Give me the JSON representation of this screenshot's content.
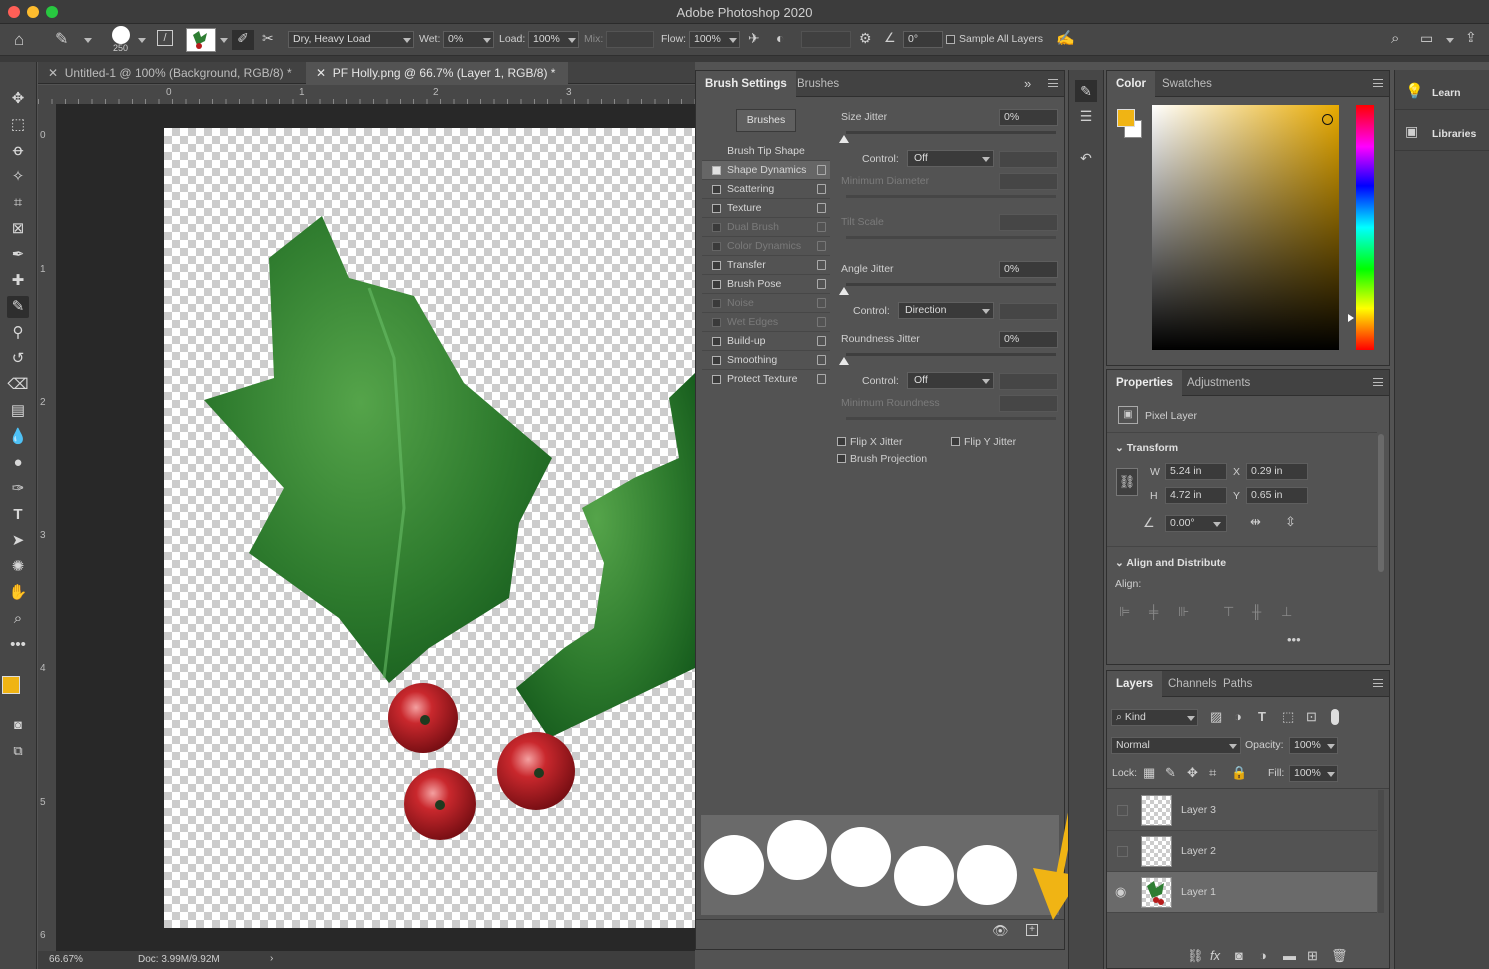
{
  "app": {
    "title": "Adobe Photoshop 2020"
  },
  "options_bar": {
    "brush_size": "250",
    "blend_preset": "Dry, Heavy Load",
    "wet_label": "Wet:",
    "wet_value": "0%",
    "load_label": "Load:",
    "load_value": "100%",
    "mix_label": "Mix:",
    "mix_value": "",
    "flow_label": "Flow:",
    "flow_value": "100%",
    "angle_value": "0°",
    "sample_all_layers": "Sample All Layers"
  },
  "doc_tabs": [
    {
      "label": "Untitled-1 @ 100% (Background, RGB/8) *"
    },
    {
      "label": "PF Holly.png @ 66.7% (Layer 1, RGB/8) *"
    }
  ],
  "ruler": {
    "h": [
      "0",
      "1",
      "2",
      "3"
    ],
    "v": [
      "0",
      "1",
      "2",
      "3",
      "4",
      "5",
      "6"
    ]
  },
  "status": {
    "zoom": "66.67%",
    "doc": "Doc: 3.99M/9.92M"
  },
  "brush_settings": {
    "tabs": [
      "Brush Settings",
      "Brushes"
    ],
    "brushes_button": "Brushes",
    "options": [
      {
        "label": "Brush Tip Shape"
      },
      {
        "label": "Shape Dynamics"
      },
      {
        "label": "Scattering"
      },
      {
        "label": "Texture"
      },
      {
        "label": "Dual Brush"
      },
      {
        "label": "Color Dynamics"
      },
      {
        "label": "Transfer"
      },
      {
        "label": "Brush Pose"
      },
      {
        "label": "Noise"
      },
      {
        "label": "Wet Edges"
      },
      {
        "label": "Build-up"
      },
      {
        "label": "Smoothing"
      },
      {
        "label": "Protect Texture"
      }
    ],
    "size_jitter_label": "Size Jitter",
    "size_jitter_value": "0%",
    "control_label": "Control:",
    "control1": "Off",
    "min_diameter": "Minimum Diameter",
    "tilt_scale": "Tilt Scale",
    "angle_jitter_label": "Angle Jitter",
    "angle_jitter_value": "0%",
    "control2": "Direction",
    "roundness_jitter_label": "Roundness Jitter",
    "roundness_jitter_value": "0%",
    "control3": "Off",
    "min_roundness": "Minimum Roundness",
    "flip_x": "Flip X Jitter",
    "flip_y": "Flip Y Jitter",
    "brush_projection": "Brush Projection"
  },
  "color_panel": {
    "tabs": [
      "Color",
      "Swatches"
    ],
    "foreground": "#f0b414",
    "background": "#ffffff"
  },
  "properties": {
    "tabs": [
      "Properties",
      "Adjustments"
    ],
    "layer_type": "Pixel Layer",
    "transform_label": "Transform",
    "w_label": "W",
    "w": "5.24 in",
    "h_label": "H",
    "h": "4.72 in",
    "x_label": "X",
    "x": "0.29 in",
    "y_label": "Y",
    "y": "0.65 in",
    "angle": "0.00°",
    "align_label": "Align and Distribute",
    "align_sub": "Align:"
  },
  "layers_panel": {
    "tabs": [
      "Layers",
      "Channels",
      "Paths"
    ],
    "kind": "Kind",
    "blend": "Normal",
    "opacity_label": "Opacity:",
    "opacity": "100%",
    "lock_label": "Lock:",
    "fill_label": "Fill:",
    "fill": "100%",
    "layers": [
      {
        "name": "Layer 3"
      },
      {
        "name": "Layer 2"
      },
      {
        "name": "Layer 1"
      }
    ]
  },
  "right_strip": {
    "learn": "Learn",
    "libraries": "Libraries"
  },
  "accent": "#f0b414"
}
